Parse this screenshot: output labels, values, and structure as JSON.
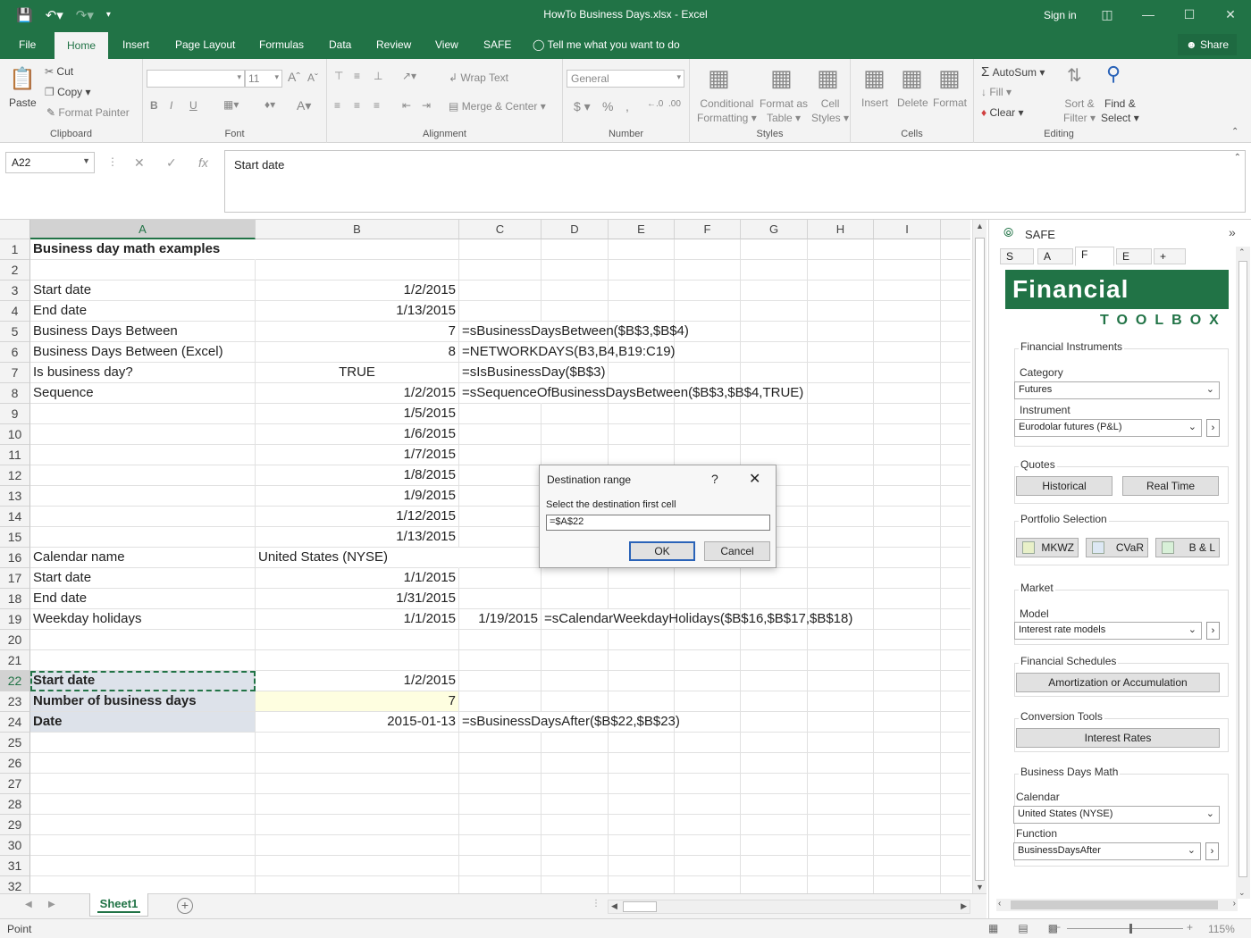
{
  "window": {
    "title": "HowTo Business Days.xlsx - Excel",
    "sign_in": "Sign in"
  },
  "menu": {
    "tabs": [
      "File",
      "Home",
      "Insert",
      "Page Layout",
      "Formulas",
      "Data",
      "Review",
      "View",
      "SAFE"
    ],
    "active": "Home",
    "tell_me": "Tell me what you want to do",
    "share": "Share"
  },
  "ribbon": {
    "clipboard": {
      "label": "Clipboard",
      "paste": "Paste",
      "cut": "Cut",
      "copy": "Copy",
      "format_painter": "Format Painter"
    },
    "font": {
      "label": "Font",
      "size": "11"
    },
    "alignment": {
      "label": "Alignment",
      "wrap_text": "Wrap Text",
      "merge_center": "Merge & Center"
    },
    "number": {
      "label": "Number",
      "format": "General"
    },
    "styles": {
      "label": "Styles",
      "conditional_1": "Conditional",
      "conditional_2": "Formatting",
      "format_table_1": "Format as",
      "format_table_2": "Table",
      "cell_styles_1": "Cell",
      "cell_styles_2": "Styles"
    },
    "cells": {
      "label": "Cells",
      "insert": "Insert",
      "delete": "Delete",
      "format": "Format"
    },
    "editing": {
      "label": "Editing",
      "autosum": "AutoSum",
      "fill": "Fill",
      "clear": "Clear",
      "sort_1": "Sort &",
      "sort_2": "Filter",
      "find_1": "Find &",
      "find_2": "Select"
    }
  },
  "formula_bar": {
    "name_box": "A22",
    "formula": "Start date"
  },
  "grid": {
    "columns": [
      "A",
      "B",
      "C",
      "D",
      "E",
      "F",
      "G",
      "H",
      "I"
    ],
    "selected_column": "A",
    "row_numbers": [
      "1",
      "2",
      "3",
      "4",
      "5",
      "6",
      "7",
      "8",
      "9",
      "10",
      "11",
      "12",
      "13",
      "14",
      "15",
      "16",
      "17",
      "18",
      "19",
      "20",
      "21",
      "22",
      "23",
      "24",
      "25",
      "26",
      "27",
      "28",
      "29",
      "30",
      "31",
      "32"
    ],
    "selected_row": "22",
    "cells": {
      "a1": "Business day math examples",
      "a3": "Start date",
      "b3": "1/2/2015",
      "a4": "End date",
      "b4": "1/13/2015",
      "a5": "Business Days Between",
      "b5": "7",
      "c5": "=sBusinessDaysBetween($B$3,$B$4)",
      "a6": "Business Days Between (Excel)",
      "b6": "8",
      "c6": "=NETWORKDAYS(B3,B4,B19:C19)",
      "a7": "Is business day?",
      "b7": "TRUE",
      "c7": "=sIsBusinessDay($B$3)",
      "a8": "Sequence",
      "b8": "1/2/2015",
      "c8": "=sSequenceOfBusinessDaysBetween($B$3,$B$4,TRUE)",
      "b9": "1/5/2015",
      "b10": "1/6/2015",
      "b11": "1/7/2015",
      "b12": "1/8/2015",
      "b13": "1/9/2015",
      "b14": "1/12/2015",
      "b15": "1/13/2015",
      "a16": "Calendar name",
      "b16": "United States (NYSE)",
      "a17": "Start date",
      "b17": "1/1/2015",
      "a18": "End date",
      "b18": "1/31/2015",
      "a19": "Weekday holidays",
      "b19": "1/1/2015",
      "c19": "1/19/2015",
      "d19": "=sCalendarWeekdayHolidays($B$16,$B$17,$B$18)",
      "a22": "Start date",
      "b22": "1/2/2015",
      "a23": "Number of business days",
      "b23": "7",
      "a24": "Date",
      "b24": "2015-01-13",
      "c24": "=sBusinessDaysAfter($B$22,$B$23)"
    }
  },
  "dialog": {
    "title": "Destination range",
    "help": "?",
    "prompt": "Select the destination first cell",
    "value": "=$A$22",
    "ok": "OK",
    "cancel": "Cancel"
  },
  "sheets": {
    "active": "Sheet1"
  },
  "status": {
    "mode": "Point",
    "zoom": "115%"
  },
  "pane": {
    "title": "SAFE",
    "tabs": [
      "S",
      "A",
      "F",
      "E",
      "+"
    ],
    "active_tab": "F",
    "banner": "Financial",
    "toolbox": "TOOLBOX",
    "instruments": {
      "title": "Financial Instruments",
      "category_label": "Category",
      "category": "Futures",
      "instrument_label": "Instrument",
      "instrument": "Eurodolar futures (P&L)"
    },
    "quotes": {
      "title": "Quotes",
      "historical": "Historical",
      "real_time": "Real Time"
    },
    "portfolio": {
      "title": "Portfolio Selection",
      "mkwz": "MKWZ",
      "cvar": "CVaR",
      "bl": "B & L"
    },
    "market": {
      "title": "Market",
      "model_label": "Model",
      "model": "Interest rate models"
    },
    "schedules": {
      "title": "Financial Schedules",
      "button": "Amortization or Accumulation"
    },
    "conversion": {
      "title": "Conversion Tools",
      "button": "Interest Rates"
    },
    "business": {
      "title": "Business Days Math",
      "calendar_label": "Calendar",
      "calendar": "United States (NYSE)",
      "function_label": "Function",
      "function": "BusinessDaysAfter"
    }
  },
  "colors": {
    "excel_green": "#217346",
    "selected_row_fill": "#dde2ea",
    "input_fill": "#fefee0"
  }
}
